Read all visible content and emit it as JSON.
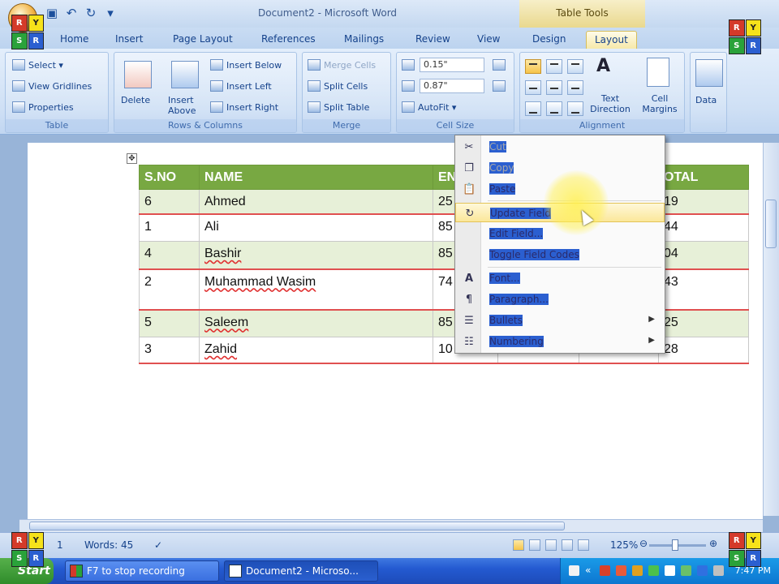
{
  "window": {
    "title": "Document2 - Microsoft Word",
    "contextual_tab_group": "Table Tools"
  },
  "tabs": [
    "Home",
    "Insert",
    "Page Layout",
    "References",
    "Mailings",
    "Review",
    "View",
    "Design",
    "Layout"
  ],
  "active_tab": "Layout",
  "ribbon": {
    "table_group": {
      "title": "Table",
      "select": "Select ▾",
      "view_gridlines": "View Gridlines",
      "properties": "Properties"
    },
    "rows_columns_group": {
      "title": "Rows & Columns",
      "delete": "Delete",
      "insert_above": "Insert Above",
      "insert_below": "Insert Below",
      "insert_left": "Insert Left",
      "insert_right": "Insert Right"
    },
    "merge_group": {
      "title": "Merge",
      "merge_cells": "Merge Cells",
      "split_cells": "Split Cells",
      "split_table": "Split Table"
    },
    "cell_size_group": {
      "title": "Cell Size",
      "height": "0.15\"",
      "width": "0.87\"",
      "autofit": "AutoFit ▾"
    },
    "alignment_group": {
      "title": "Alignment",
      "text_direction": "Text Direction",
      "cell_margins": "Cell Margins"
    },
    "data_group": {
      "title": "Data"
    }
  },
  "table": {
    "headers": [
      "S.NO",
      "NAME",
      "EN",
      "",
      "",
      "OTAL"
    ],
    "rows": [
      {
        "sno": "6",
        "name": "Ahmed",
        "en": "25",
        "total": "19"
      },
      {
        "sno": "1",
        "name": "Ali",
        "en": "85",
        "total": "44"
      },
      {
        "sno": "4",
        "name": "Bashir",
        "en": "85",
        "total": "04"
      },
      {
        "sno": "2",
        "name": "Muhammad Wasim",
        "en": "74",
        "total": "43"
      },
      {
        "sno": "5",
        "name": "Saleem",
        "en": "85",
        "total": "25"
      },
      {
        "sno": "3",
        "name": "Zahid",
        "en": "10",
        "total": "28"
      }
    ]
  },
  "context_menu": {
    "items": [
      {
        "label": "Cut",
        "icon": "scissors-icon",
        "disabled": true
      },
      {
        "label": "Copy",
        "icon": "copy-icon",
        "disabled": true
      },
      {
        "label": "Paste",
        "icon": "paste-icon",
        "disabled": false
      },
      {
        "label": "Update Field",
        "icon": "update-field-icon",
        "disabled": false,
        "highlighted": true
      },
      {
        "label": "Edit Field...",
        "icon": "",
        "disabled": false
      },
      {
        "label": "Toggle Field Codes",
        "icon": "",
        "disabled": false
      },
      {
        "label": "Font...",
        "icon": "font-icon",
        "disabled": false
      },
      {
        "label": "Paragraph...",
        "icon": "paragraph-icon",
        "disabled": false
      },
      {
        "label": "Bullets",
        "icon": "bullets-icon",
        "disabled": false,
        "submenu": true
      },
      {
        "label": "Numbering",
        "icon": "numbering-icon",
        "disabled": false,
        "submenu": true
      }
    ]
  },
  "status_bar": {
    "page": "1",
    "words": "Words: 45",
    "zoom": "125%"
  },
  "taskbar": {
    "start": "Start",
    "tasks": [
      "F7 to stop recording",
      "Document2 - Microso..."
    ],
    "clock": "7:47 PM"
  },
  "colors": {
    "header_green": "#78a842",
    "ribbon_blue": "#cfe0f5",
    "highlight_yellow": "#fbe79a"
  }
}
